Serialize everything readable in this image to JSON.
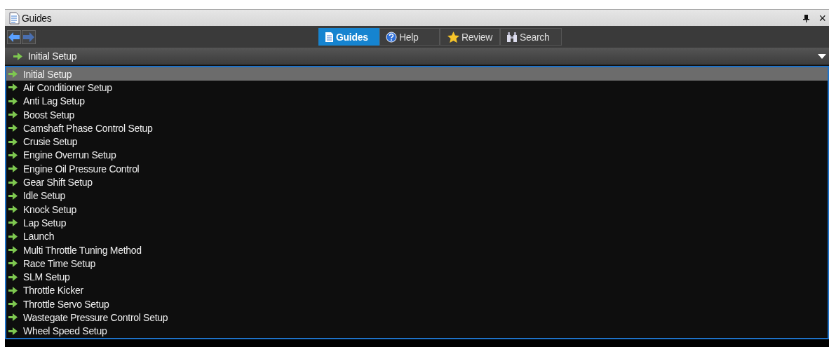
{
  "window": {
    "title": "Guides",
    "close": "×"
  },
  "tabs": [
    {
      "label": "Guides",
      "kind": "doc",
      "selected": true
    },
    {
      "label": "Help",
      "kind": "help",
      "selected": false
    },
    {
      "label": "Review",
      "kind": "star",
      "selected": false
    },
    {
      "label": "Search",
      "kind": "binoculars",
      "selected": false
    }
  ],
  "dropdown": {
    "value": "Initial Setup"
  },
  "items": [
    {
      "label": "Initial Setup",
      "selected": true
    },
    {
      "label": "Air Conditioner Setup",
      "selected": false
    },
    {
      "label": "Anti Lag Setup",
      "selected": false
    },
    {
      "label": "Boost Setup",
      "selected": false
    },
    {
      "label": "Camshaft Phase Control Setup",
      "selected": false
    },
    {
      "label": "Crusie Setup",
      "selected": false
    },
    {
      "label": "Engine Overrun Setup",
      "selected": false
    },
    {
      "label": "Engine Oil Pressure Control",
      "selected": false
    },
    {
      "label": "Gear Shift Setup",
      "selected": false
    },
    {
      "label": "Idle Setup",
      "selected": false
    },
    {
      "label": "Knock Setup",
      "selected": false
    },
    {
      "label": "Lap Setup",
      "selected": false
    },
    {
      "label": "Launch",
      "selected": false
    },
    {
      "label": "Multi Throttle Tuning Method",
      "selected": false
    },
    {
      "label": "Race Time Setup",
      "selected": false
    },
    {
      "label": "SLM Setup",
      "selected": false
    },
    {
      "label": "Throttle Kicker",
      "selected": false
    },
    {
      "label": "Throttle Servo Setup",
      "selected": false
    },
    {
      "label": "Wastegate Pressure Control Setup",
      "selected": false
    },
    {
      "label": "Wheel Speed Setup",
      "selected": false
    }
  ]
}
